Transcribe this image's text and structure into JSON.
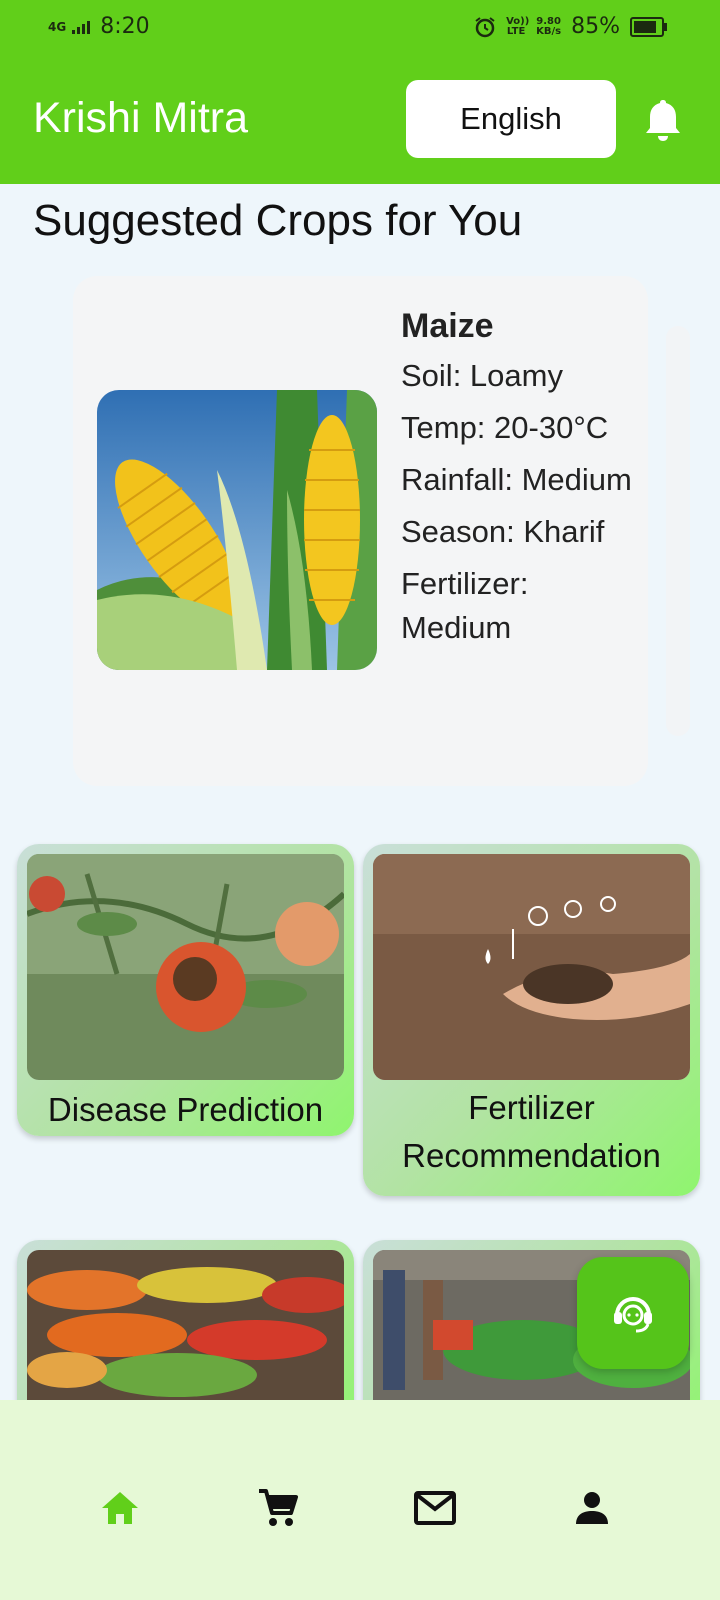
{
  "status_bar": {
    "network": "4G",
    "time": "8:20",
    "volte": "Vo)) LTE",
    "speed": "9.80",
    "speed_unit": "KB/s",
    "battery": "85%",
    "battery_level": 0.85
  },
  "header": {
    "title": "Krishi Mitra",
    "language_button": "English",
    "bell_icon": "bell-icon"
  },
  "suggested": {
    "title": "Suggested Crops for You",
    "crops": [
      {
        "name": "Maize",
        "soil": "Soil: Loamy",
        "temp": "Temp: 20-30°C",
        "rainfall": "Rainfall: Medium",
        "season": "Season: Kharif",
        "fertilizer": "Fertilizer: Medium"
      }
    ]
  },
  "features": [
    {
      "label": "Disease Prediction"
    },
    {
      "label": "Fertilizer Recommendation"
    },
    {
      "label": ""
    },
    {
      "label": ""
    }
  ],
  "fab": {
    "icon": "support-agent-icon"
  },
  "bottom_nav": {
    "items": [
      {
        "icon": "home-icon",
        "active": true
      },
      {
        "icon": "cart-icon",
        "active": false
      },
      {
        "icon": "mail-icon",
        "active": false
      },
      {
        "icon": "profile-icon",
        "active": false
      }
    ]
  },
  "colors": {
    "primary": "#61cf1a",
    "nav_background": "#e6f9d6",
    "active_nav": "#61cf1a"
  }
}
